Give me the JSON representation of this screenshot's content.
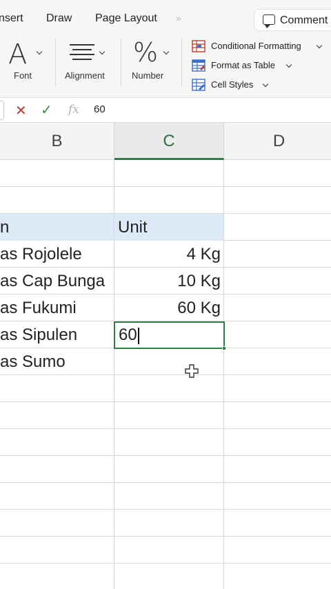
{
  "ribbon_tabs": {
    "insert": "nsert",
    "draw": "Draw",
    "page_layout": "Page Layout",
    "more": "»",
    "comments": "Comment"
  },
  "ribbon": {
    "font_label": "Font",
    "alignment_label": "Alignment",
    "number_label": "Number",
    "font_glyph": "A",
    "number_glyph": "%",
    "styles": {
      "conditional_formatting": "Conditional Formatting",
      "format_as_table": "Format as Table",
      "cell_styles": "Cell Styles"
    }
  },
  "formula_bar": {
    "cancel": "✕",
    "enter": "✓",
    "fx": "fx",
    "value": "60"
  },
  "columns": [
    "B",
    "C",
    "D"
  ],
  "active_column": "C",
  "sheet": {
    "header_b": "n",
    "header_c": "Unit",
    "rows": [
      {
        "b": "as Rojolele",
        "c": "4 Kg"
      },
      {
        "b": "as Cap Bunga",
        "c": "10 Kg"
      },
      {
        "b": "as Fukumi",
        "c": "60 Kg"
      },
      {
        "b": "as Sipulen",
        "c": "60"
      },
      {
        "b": "as Sumo",
        "c": ""
      }
    ]
  },
  "colors": {
    "accent_green": "#2e7d47",
    "header_fill": "#dde9f7",
    "cancel_red": "#c0392b"
  }
}
